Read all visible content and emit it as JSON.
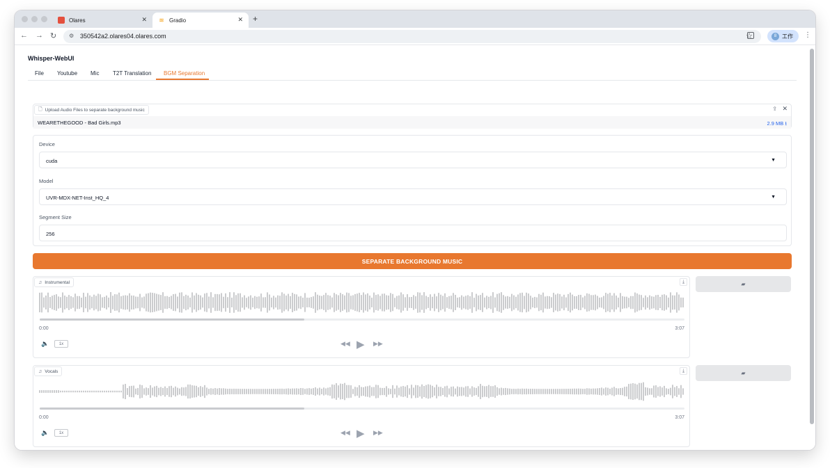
{
  "browser": {
    "tabs": [
      {
        "title": "Olares",
        "active": false,
        "favicon_color": "#e4503e"
      },
      {
        "title": "Gradio",
        "active": true,
        "favicon_color": "#f59e0b"
      }
    ],
    "new_tab_symbol": "+",
    "url": "350542a2.olares04.olares.com",
    "profile_label": "工作",
    "profile_avatar": "8"
  },
  "app": {
    "title": "Whisper-WebUI",
    "tabs": [
      {
        "label": "File",
        "selected": false
      },
      {
        "label": "Youtube",
        "selected": false
      },
      {
        "label": "Mic",
        "selected": false
      },
      {
        "label": "T2T Translation",
        "selected": false
      },
      {
        "label": "BGM Separation",
        "selected": true
      }
    ]
  },
  "upload": {
    "label": "Upload Audio Files to separate background music",
    "file_name": "WEARETHEGOOD - Bad Girls.mp3",
    "file_size": "2.9 MB ⭳"
  },
  "settings": {
    "device_label": "Device",
    "device_value": "cuda",
    "model_label": "Model",
    "model_value": "UVR-MDX-NET-Inst_HQ_4",
    "segment_label": "Segment Size",
    "segment_value": "256"
  },
  "separate_button": "SEPARATE BACKGROUND MUSIC",
  "outputs": [
    {
      "label": "Instrumental",
      "time_start": "0:00",
      "time_end": "3:07",
      "playback_rate": "1x",
      "progress": 0.41
    },
    {
      "label": "Vocals",
      "time_start": "0:00",
      "time_end": "3:07",
      "playback_rate": "1x",
      "progress": 0.41
    }
  ],
  "colors": {
    "accent": "#e8782f",
    "link": "#2563eb",
    "waveform": "#a8a9ad"
  },
  "icons": {
    "back": "arrow-left-icon",
    "forward": "arrow-right-icon",
    "reload": "reload-icon",
    "music": "music-note-icon",
    "download": "download-icon",
    "upload": "upload-icon",
    "close": "close-icon",
    "play": "play-icon",
    "rewind": "rewind-icon",
    "fast_forward": "fast-forward-icon",
    "volume": "volume-icon",
    "folder": "folder-icon"
  }
}
